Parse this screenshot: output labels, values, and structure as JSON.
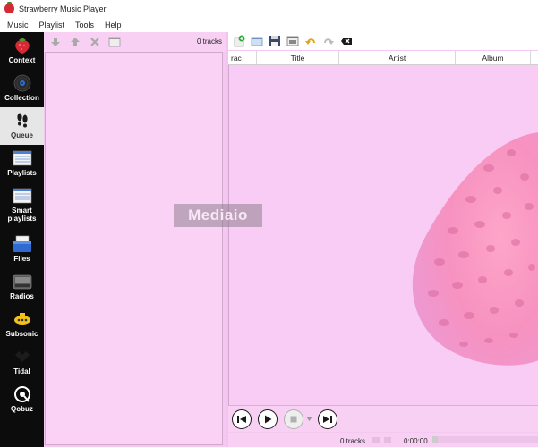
{
  "window": {
    "title": "Strawberry Music Player",
    "accent": "#0c0c0c"
  },
  "menu": {
    "items": [
      "Music",
      "Playlist",
      "Tools",
      "Help"
    ]
  },
  "sidebar": {
    "items": [
      {
        "label": "Context",
        "icon": "strawberry-icon"
      },
      {
        "label": "Collection",
        "icon": "vinyl-disc-icon"
      },
      {
        "label": "Queue",
        "icon": "footprints-icon",
        "active": true
      },
      {
        "label": "Playlists",
        "icon": "playlist-icon"
      },
      {
        "label": "Smart",
        "label2": "playlists",
        "icon": "smart-playlist-icon"
      },
      {
        "label": "Files",
        "icon": "files-icon"
      },
      {
        "label": "Radios",
        "icon": "radio-icon"
      },
      {
        "label": "Subsonic",
        "icon": "subsonic-icon"
      },
      {
        "label": "Tidal",
        "icon": "tidal-icon"
      },
      {
        "label": "Qobuz",
        "icon": "qobuz-icon"
      }
    ]
  },
  "queue": {
    "track_count": "0 tracks",
    "toolbar_icons": [
      "move-down-icon",
      "move-up-icon",
      "remove-icon",
      "clear-icon"
    ]
  },
  "playlist": {
    "toolbar_icons": [
      "new-playlist-icon",
      "load-playlist-icon",
      "save-playlist-icon",
      "playlist-settings-icon",
      "undo-icon",
      "redo-icon",
      "clear-playlist-icon"
    ],
    "columns": [
      "rac",
      "Title",
      "Artist",
      "Album"
    ]
  },
  "player": {
    "buttons": [
      "previous-track-icon",
      "play-icon",
      "stop-icon",
      "next-track-icon"
    ]
  },
  "status": {
    "track_count": "0 tracks",
    "time": "0:00:00"
  },
  "watermark": {
    "text": "Mediaio"
  }
}
